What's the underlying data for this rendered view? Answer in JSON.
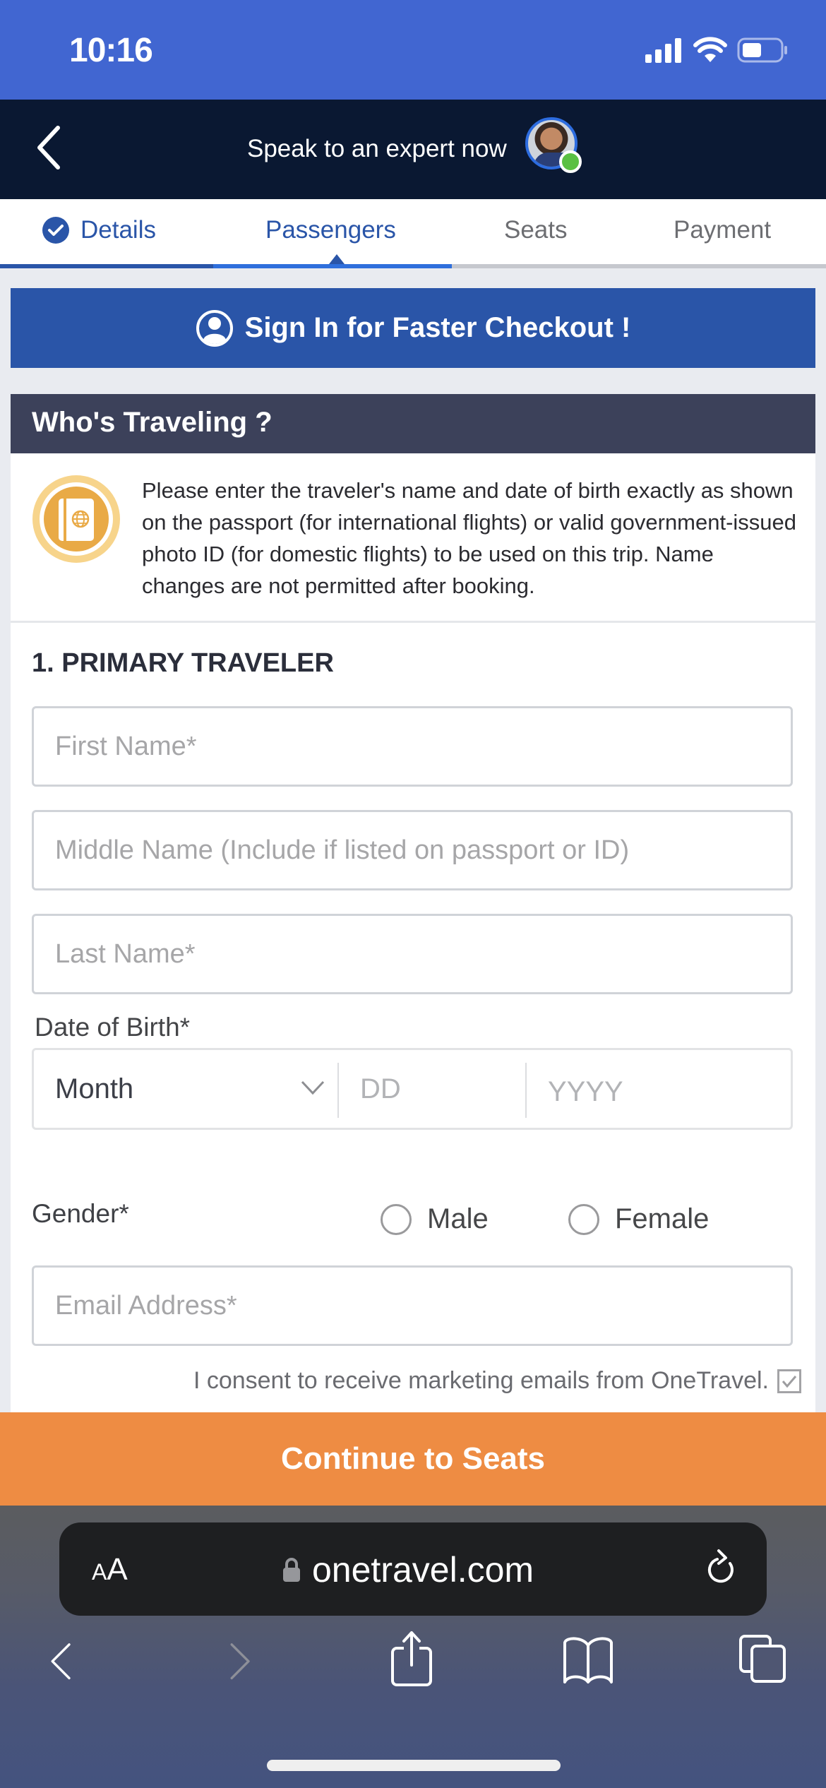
{
  "status_bar": {
    "time": "10:16"
  },
  "top_bar": {
    "expert_text": "Speak to an expert now"
  },
  "tabs": [
    {
      "label": "Details",
      "state": "completed"
    },
    {
      "label": "Passengers",
      "state": "active"
    },
    {
      "label": "Seats",
      "state": "upcoming"
    },
    {
      "label": "Payment",
      "state": "upcoming"
    }
  ],
  "signin_banner": {
    "label": "Sign In for Faster Checkout !"
  },
  "whos_traveling": {
    "title": "Who's Traveling ?",
    "notice": "Please enter the traveler's name and date of birth exactly as shown on the passport (for international flights) or valid government-issued photo ID (for domestic flights) to be used on this trip. Name changes are not permitted after booking."
  },
  "traveler": {
    "section_title": "1. PRIMARY TRAVELER",
    "first_name": {
      "value": "",
      "placeholder": "First Name*"
    },
    "middle_name": {
      "value": "",
      "placeholder": "Middle Name (Include if listed on passport or ID)"
    },
    "last_name": {
      "value": "",
      "placeholder": "Last Name*"
    },
    "dob": {
      "label": "Date of Birth*",
      "month": "Month",
      "day_placeholder": "DD",
      "year_placeholder": "YYYY"
    },
    "gender": {
      "label": "Gender*",
      "options": [
        "Male",
        "Female"
      ],
      "selected": null
    },
    "email": {
      "value": "",
      "placeholder": "Email Address*"
    },
    "consent": {
      "label": "I consent to receive marketing emails from OneTravel.",
      "checked": true
    }
  },
  "cta": {
    "label": "Continue to Seats"
  },
  "browser": {
    "text_size_label_small": "A",
    "text_size_label_large": "A",
    "url": "onetravel.com"
  },
  "colors": {
    "status_bar": "#4166d1",
    "top_bar": "#0a1832",
    "brand_blue": "#2a55a8",
    "active_blue": "#2f6fdc",
    "header_slate": "#3c415a",
    "cta_orange": "#ee8c43",
    "online_green": "#5ac043",
    "passport_gold": "#e9aa46"
  }
}
